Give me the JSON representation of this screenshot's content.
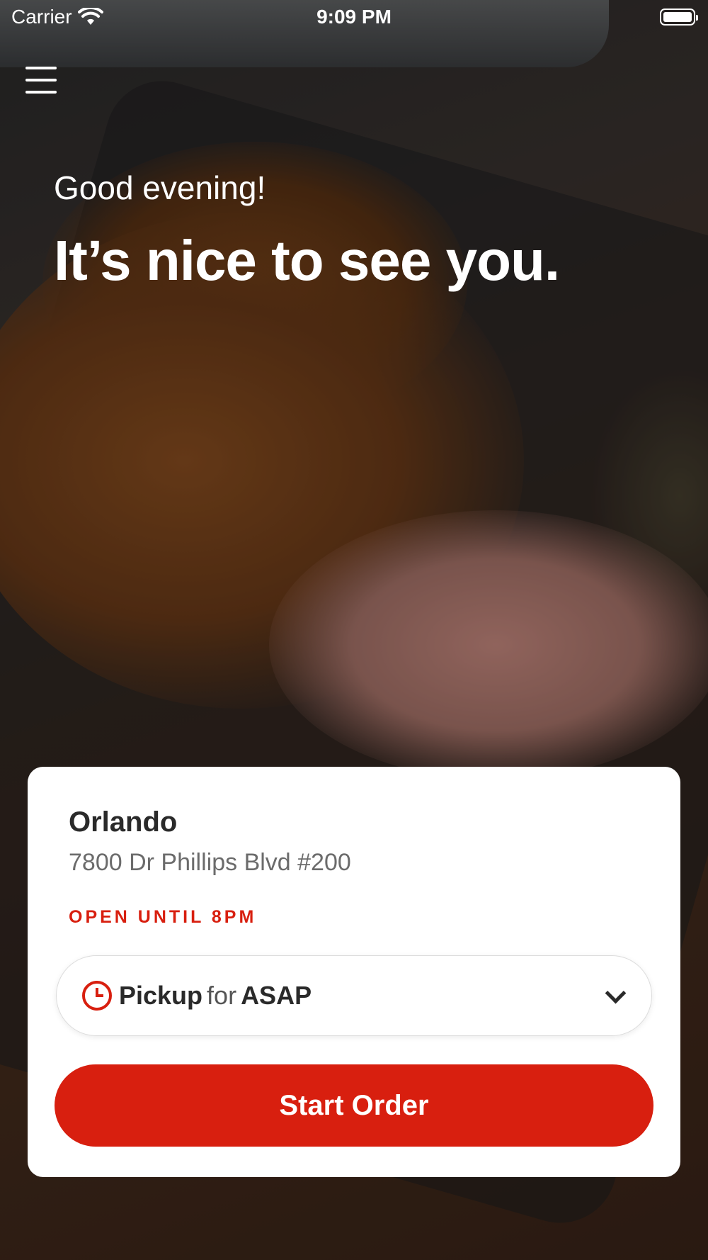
{
  "status_bar": {
    "carrier": "Carrier",
    "time": "9:09 PM"
  },
  "hero": {
    "greeting": "Good evening!",
    "headline": "It’s nice to see you."
  },
  "location": {
    "name": "Orlando",
    "address": "7800 Dr Phillips Blvd #200",
    "hours": "OPEN UNTIL 8PM"
  },
  "order_mode": {
    "mode": "Pickup",
    "connector": "for",
    "time": "ASAP"
  },
  "actions": {
    "start_order_label": "Start Order"
  },
  "colors": {
    "accent": "#d81f0f",
    "text": "#2a2a2a",
    "secondary_text": "#6b6b6b"
  },
  "icons": [
    "wifi-icon",
    "battery-icon",
    "menu-icon",
    "clock-icon",
    "chevron-down-icon"
  ]
}
